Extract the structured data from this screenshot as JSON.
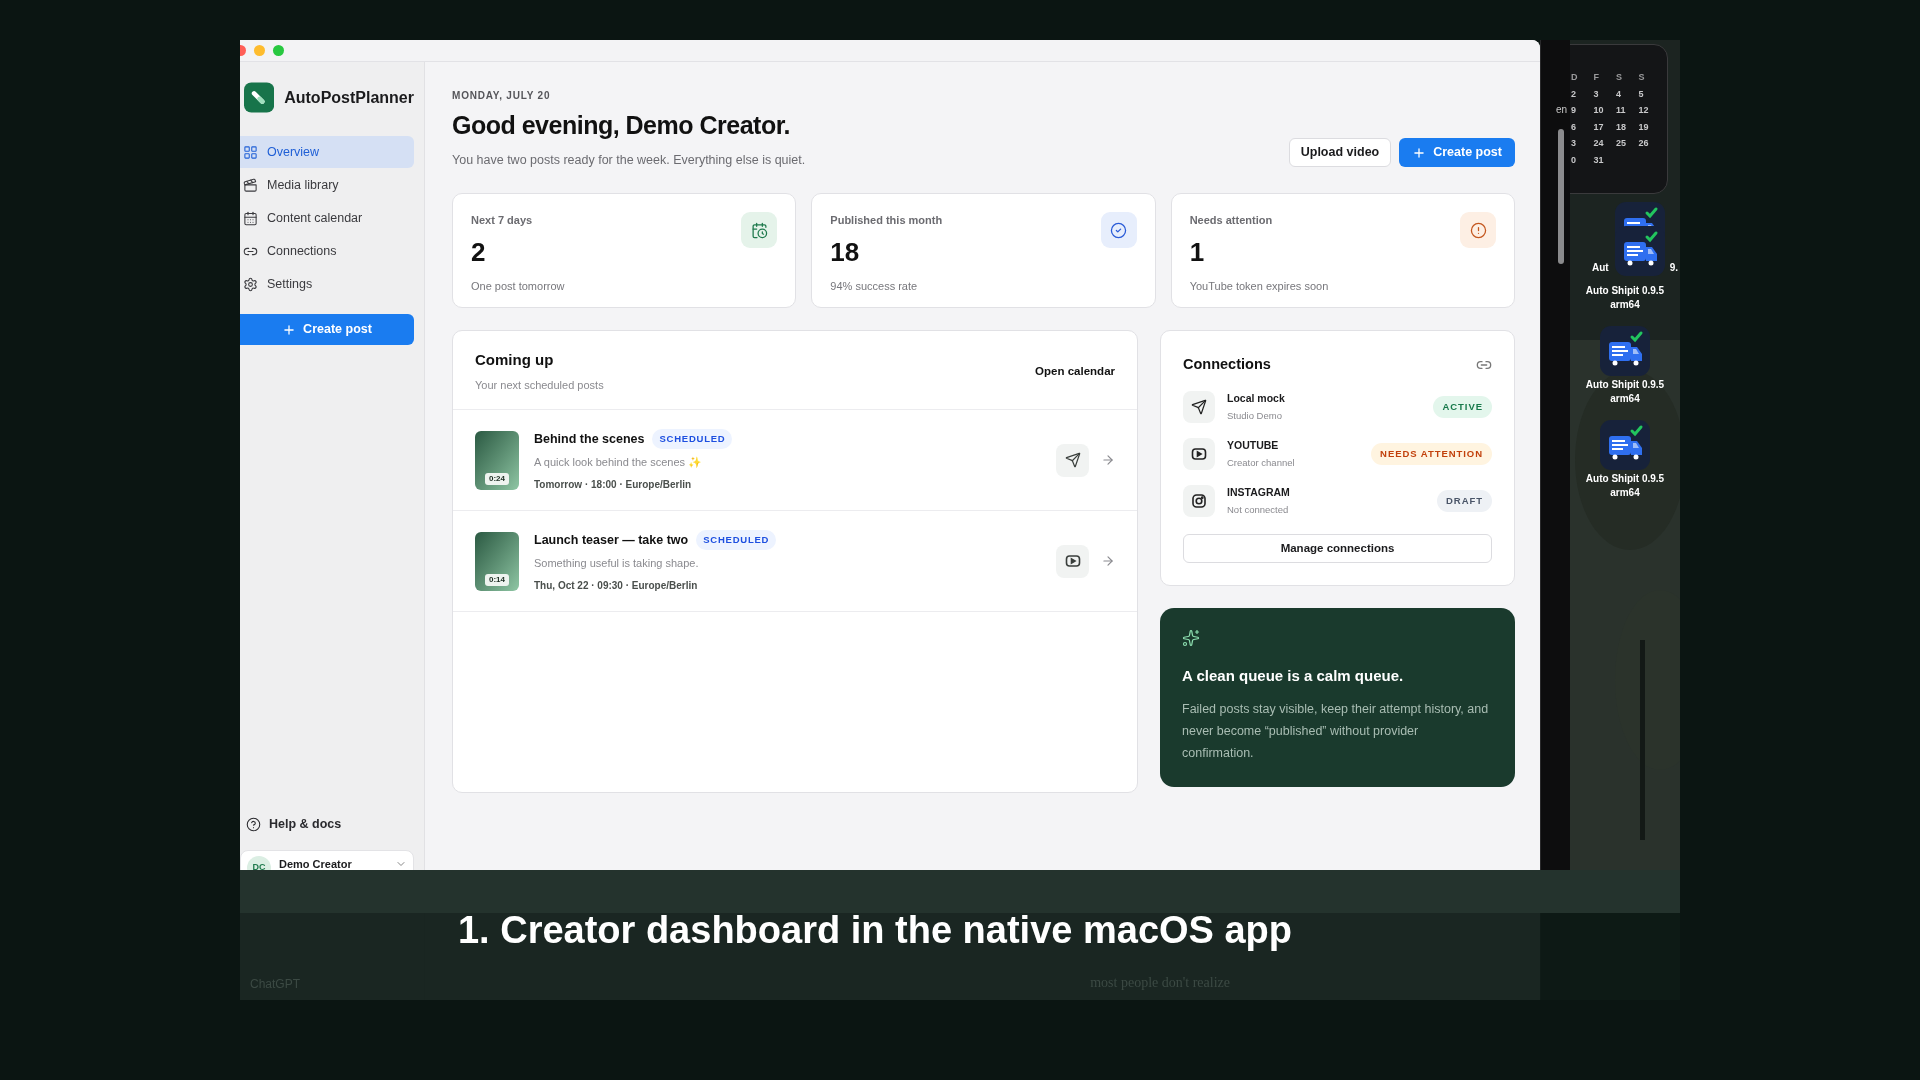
{
  "sidebar": {
    "app_name": "AutoPostPlanner",
    "items": [
      {
        "label": "Overview",
        "selected": true
      },
      {
        "label": "Media library",
        "selected": false
      },
      {
        "label": "Content calendar",
        "selected": false
      },
      {
        "label": "Connections",
        "selected": false
      },
      {
        "label": "Settings",
        "selected": false
      }
    ],
    "create_button": "Create post",
    "help": "Help & docs",
    "user": {
      "initials": "DC",
      "name": "Demo Creator"
    }
  },
  "header": {
    "date": "MONDAY, JULY 20",
    "title": "Good evening, Demo Creator.",
    "subtitle": "You have two posts ready for the week. Everything else is quiet.",
    "buttons": [
      {
        "label": "Upload video",
        "kind": "secondary"
      },
      {
        "label": "Create post",
        "kind": "primary"
      }
    ]
  },
  "stats": [
    {
      "label": "Next 7 days",
      "value": "2",
      "note": "One post tomorrow",
      "kind": "calendar"
    },
    {
      "label": "Published this month",
      "value": "18",
      "note": "94% success rate",
      "kind": "check"
    },
    {
      "label": "Needs attention",
      "value": "1",
      "note": "YouTube token expires soon",
      "kind": "alert"
    }
  ],
  "coming_up": {
    "title": "Coming up",
    "subtitle": "Your next scheduled posts",
    "action": "Open calendar",
    "posts": [
      {
        "title": "Behind the scenes",
        "status": "SCHEDULED",
        "caption": "A quick look behind the scenes ✨",
        "when": "Tomorrow · 18:00 · Europe/Berlin",
        "duration": "0:24"
      },
      {
        "title": "Launch teaser — take two",
        "status": "SCHEDULED",
        "caption": "Something useful is taking shape.",
        "when": "Thu, Oct 22 · 09:30 · Europe/Berlin",
        "duration": "0:14"
      }
    ]
  },
  "connections": {
    "title": "Connections",
    "items": [
      {
        "name": "Local mock",
        "detail": "Studio Demo",
        "status": "ACTIVE",
        "kind": "active"
      },
      {
        "name": "YOUTUBE",
        "detail": "Creator channel",
        "status": "NEEDS ATTENTION",
        "kind": "attention"
      },
      {
        "name": "INSTAGRAM",
        "detail": "Not connected",
        "status": "DRAFT",
        "kind": "draft"
      }
    ],
    "button": "Manage connections"
  },
  "tip": {
    "title": "A clean queue is a calm queue.",
    "body": "Failed posts stay visible, keep their attempt history, and never become “published” without provider confirmation."
  },
  "side_window": {
    "text": "en"
  },
  "desktop": {
    "calendar": {
      "header": [
        "D",
        "F",
        "S",
        "S"
      ],
      "rows": [
        [
          "2",
          "3",
          "4",
          "5"
        ],
        [
          "9",
          "10",
          "11",
          "12"
        ],
        [
          "6",
          "17",
          "18",
          "19"
        ],
        [
          "3",
          "24",
          "25",
          "26"
        ],
        [
          "0",
          "31"
        ]
      ]
    },
    "partial_label": [
      "Aut",
      "9."
    ],
    "icons": [
      {
        "label": "Auto Shipit 0.9.5 arm64"
      },
      {
        "label": "Auto Shipit 0.9.5 arm64"
      },
      {
        "label": "Auto Shipit 0.9.5 arm64"
      }
    ]
  },
  "background_texts": [
    "ChatGPT",
    "most people don't realize"
  ],
  "caption": "1. Creator dashboard in the native macOS app"
}
